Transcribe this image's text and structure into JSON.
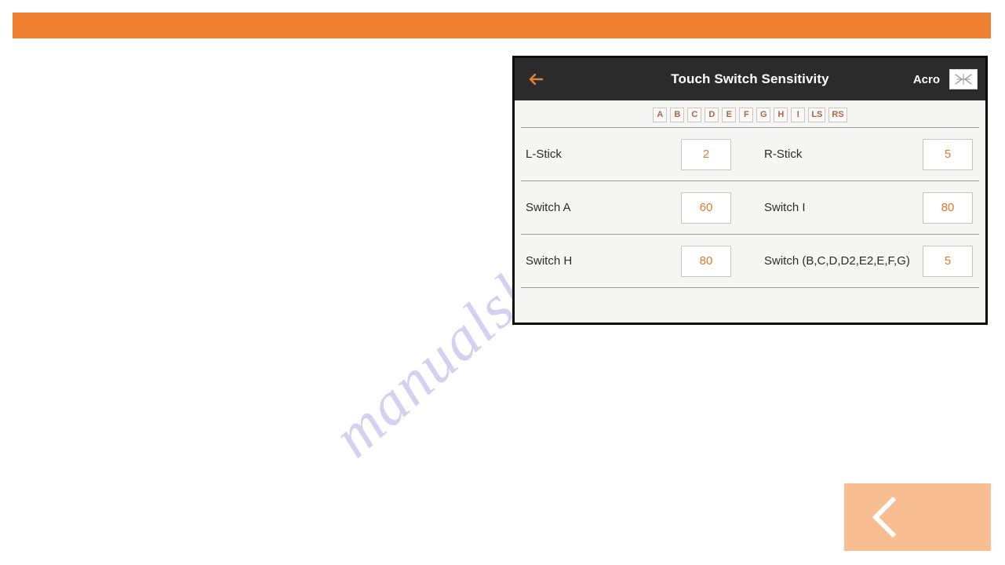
{
  "page": {
    "banner_color": "#ef7f31",
    "watermark": "manualshive.com"
  },
  "device": {
    "header": {
      "back_icon": "back-arrow-icon",
      "title": "Touch Switch Sensitivity",
      "model_name": "Acro",
      "model_icon": "airplane-icon"
    },
    "tabs": [
      {
        "label": "A"
      },
      {
        "label": "B"
      },
      {
        "label": "C"
      },
      {
        "label": "D"
      },
      {
        "label": "E"
      },
      {
        "label": "F"
      },
      {
        "label": "G"
      },
      {
        "label": "H"
      },
      {
        "label": "I"
      },
      {
        "label": "LS"
      },
      {
        "label": "RS"
      }
    ],
    "rows": [
      {
        "left_label": "L-Stick",
        "left_value": "2",
        "right_label": "R-Stick",
        "right_value": "5"
      },
      {
        "left_label": "Switch A",
        "left_value": "60",
        "right_label": "Switch I",
        "right_value": "80"
      },
      {
        "left_label": "Switch H",
        "left_value": "80",
        "right_label": "Switch (B,C,D,D2,E2,E,F,G)",
        "right_value": "5"
      }
    ]
  },
  "pager": {
    "prev_icon": "chevron-left-icon",
    "background_color": "#f8bd91"
  }
}
